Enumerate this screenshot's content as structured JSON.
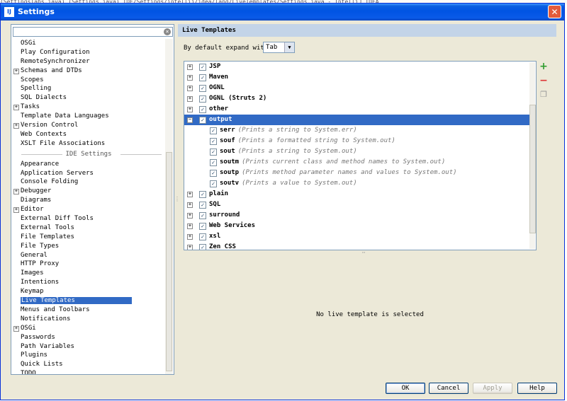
{
  "background": {
    "text": "(SettingsTabs.java)  (Settings.java)  IDE/Settings/intellij/idea/lang/LiveTemplates/Settings.java  - IntelliJ IDEA"
  },
  "window": {
    "title": "Settings",
    "icon_text": "IJ",
    "close": "✕"
  },
  "left_panel": {
    "search_placeholder": "",
    "project_items": [
      {
        "label": "OSGi",
        "expandable": false
      },
      {
        "label": "Play Configuration",
        "expandable": false
      },
      {
        "label": "RemoteSynchronizer",
        "expandable": false
      },
      {
        "label": "Schemas and DTDs",
        "expandable": true
      },
      {
        "label": "Scopes",
        "expandable": false
      },
      {
        "label": "Spelling",
        "expandable": false
      },
      {
        "label": "SQL Dialects",
        "expandable": false
      },
      {
        "label": "Tasks",
        "expandable": true
      },
      {
        "label": "Template Data Languages",
        "expandable": false
      },
      {
        "label": "Version Control",
        "expandable": true
      },
      {
        "label": "Web Contexts",
        "expandable": false
      },
      {
        "label": "XSLT File Associations",
        "expandable": false
      }
    ],
    "ide_header": "IDE Settings",
    "ide_items": [
      {
        "label": "Appearance",
        "expandable": false
      },
      {
        "label": "Application Servers",
        "expandable": false
      },
      {
        "label": "Console Folding",
        "expandable": false
      },
      {
        "label": "Debugger",
        "expandable": true
      },
      {
        "label": "Diagrams",
        "expandable": false
      },
      {
        "label": "Editor",
        "expandable": true
      },
      {
        "label": "External Diff Tools",
        "expandable": false
      },
      {
        "label": "External Tools",
        "expandable": false
      },
      {
        "label": "File Templates",
        "expandable": false
      },
      {
        "label": "File Types",
        "expandable": false
      },
      {
        "label": "General",
        "expandable": false
      },
      {
        "label": "HTTP Proxy",
        "expandable": false
      },
      {
        "label": "Images",
        "expandable": false
      },
      {
        "label": "Intentions",
        "expandable": false
      },
      {
        "label": "Keymap",
        "expandable": false
      },
      {
        "label": "Live Templates",
        "expandable": false,
        "selected": true
      },
      {
        "label": "Menus and Toolbars",
        "expandable": false
      },
      {
        "label": "Notifications",
        "expandable": false
      },
      {
        "label": "OSGi",
        "expandable": true
      },
      {
        "label": "Passwords",
        "expandable": false
      },
      {
        "label": "Path Variables",
        "expandable": false
      },
      {
        "label": "Plugins",
        "expandable": false
      },
      {
        "label": "Quick Lists",
        "expandable": false
      },
      {
        "label": "TODO",
        "expandable": false
      }
    ]
  },
  "right_panel": {
    "title": "Live Templates",
    "expand_label": "By default expand with",
    "expand_value": "Tab",
    "templates": [
      {
        "type": "group",
        "name": "JSP",
        "checked": true
      },
      {
        "type": "group",
        "name": "Maven",
        "checked": true
      },
      {
        "type": "group",
        "name": "OGNL",
        "checked": true
      },
      {
        "type": "group",
        "name": "OGNL (Struts 2)",
        "checked": true
      },
      {
        "type": "group",
        "name": "other",
        "checked": true
      },
      {
        "type": "group",
        "name": "output",
        "checked": true,
        "expanded": true,
        "selected": true
      },
      {
        "type": "item",
        "abbr": "serr",
        "desc": "(Prints a string to System.err)",
        "checked": true
      },
      {
        "type": "item",
        "abbr": "souf",
        "desc": "(Prints a formatted string to System.out)",
        "checked": true
      },
      {
        "type": "item",
        "abbr": "sout",
        "desc": "(Prints a string to System.out)",
        "checked": true
      },
      {
        "type": "item",
        "abbr": "soutm",
        "desc": "(Prints current class and method names to System.out)",
        "checked": true
      },
      {
        "type": "item",
        "abbr": "soutp",
        "desc": "(Prints method parameter names and values to System.out)",
        "checked": true
      },
      {
        "type": "item",
        "abbr": "soutv",
        "desc": "(Prints a value to System.out)",
        "checked": true
      },
      {
        "type": "group",
        "name": "plain",
        "checked": true
      },
      {
        "type": "group",
        "name": "SQL",
        "checked": true
      },
      {
        "type": "group",
        "name": "surround",
        "checked": true
      },
      {
        "type": "group",
        "name": "Web Services",
        "checked": true
      },
      {
        "type": "group",
        "name": "xsl",
        "checked": true
      },
      {
        "type": "group",
        "name": "Zen CSS",
        "checked": true
      }
    ],
    "tools": {
      "add": "+",
      "remove": "−",
      "copy": "❐"
    },
    "detail_text": "No live template is selected"
  },
  "buttons": {
    "ok": "OK",
    "cancel": "Cancel",
    "apply": "Apply",
    "help": "Help"
  },
  "colors": {
    "selection": "#316ac5",
    "titlebar": "#0054e3",
    "panel_header": "#c3d4e8"
  }
}
